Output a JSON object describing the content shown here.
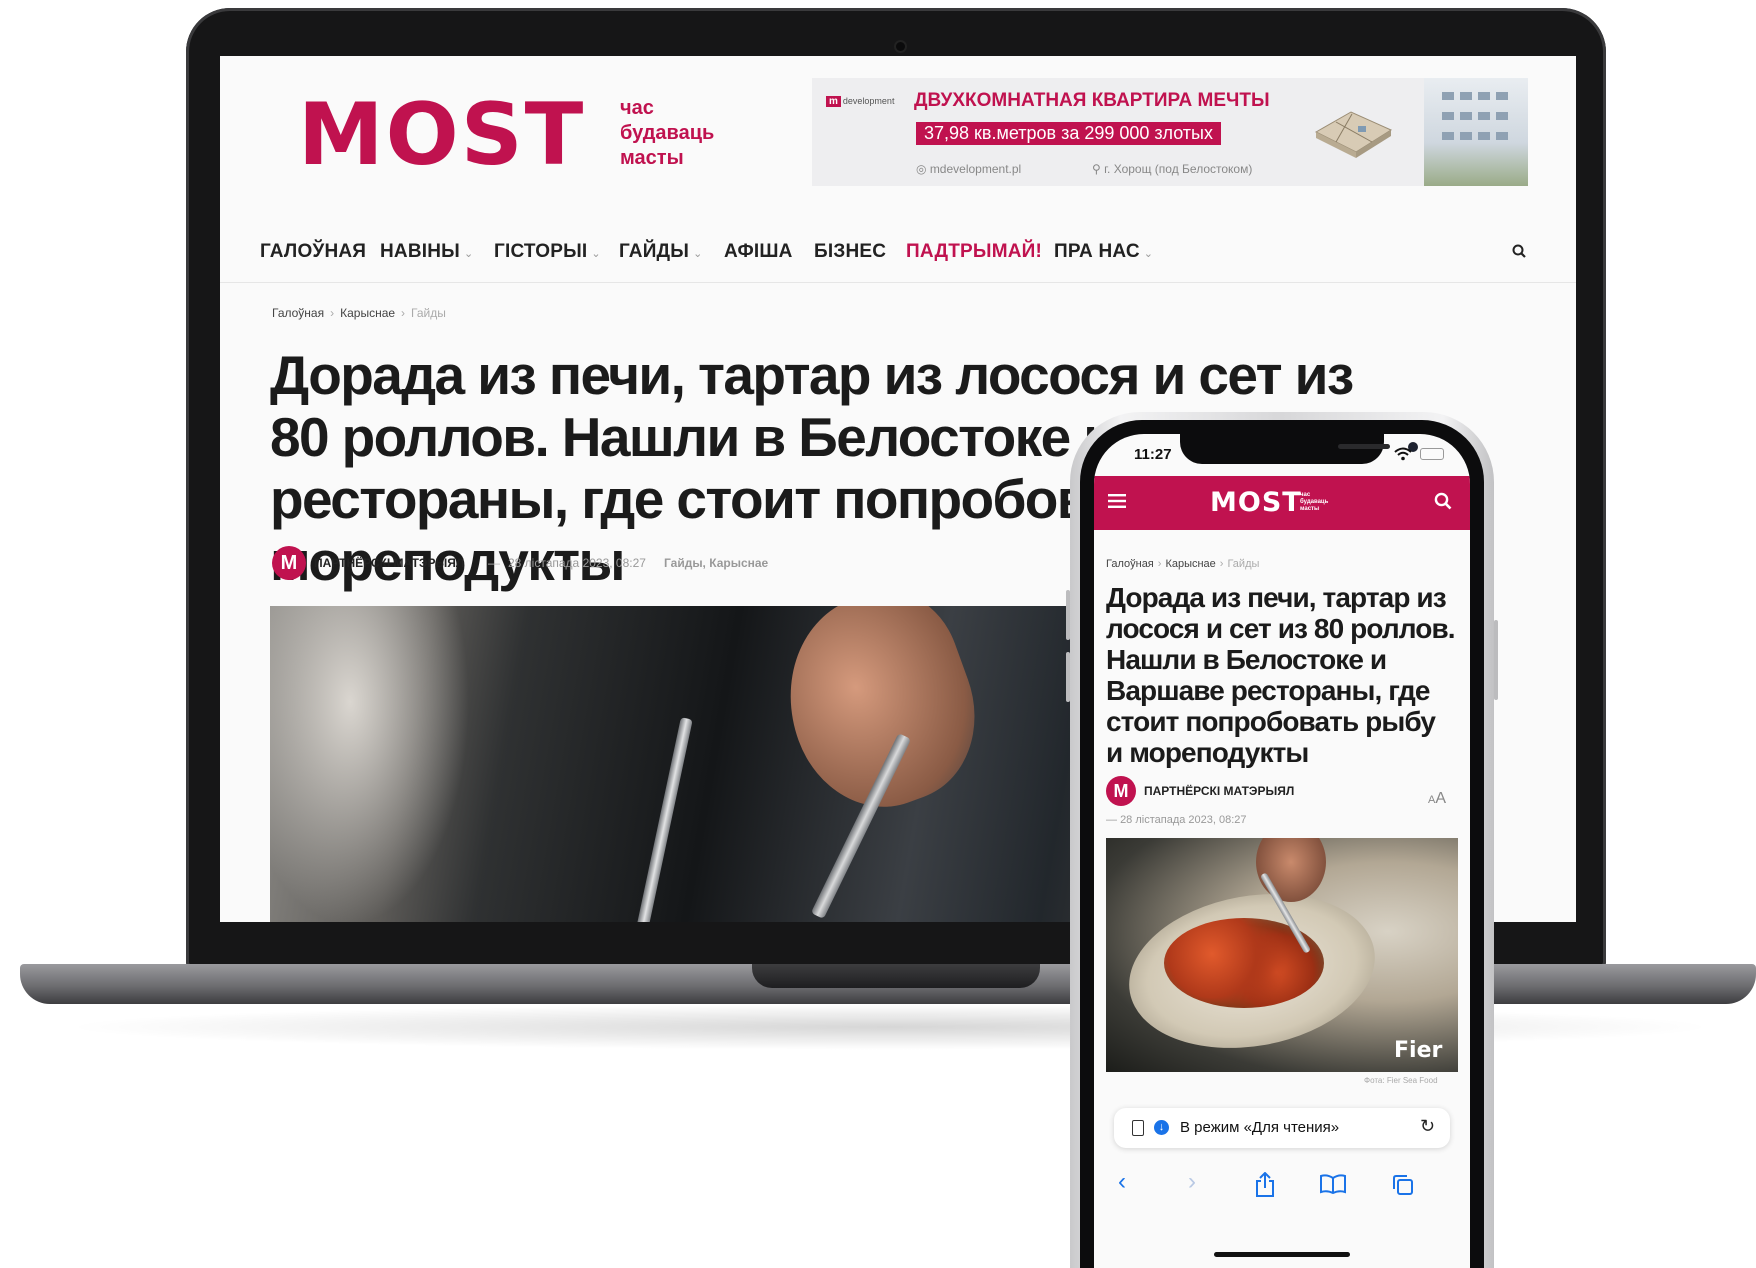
{
  "site": {
    "logo": "MOST",
    "tagline": [
      "час",
      "будаваць",
      "масты"
    ]
  },
  "ad": {
    "brand_mark": "m",
    "brand": "development",
    "headline": "ДВУХКОМНАТНАЯ КВАРТИРА МЕЧТЫ",
    "offer": "37,98 кв.метров за 299 000 злотых",
    "site": "mdevelopment.pl",
    "address": "г. Хорощ (под Белостоком)"
  },
  "nav": {
    "items": [
      {
        "label": "ГАЛОЎНАЯ",
        "has_menu": false
      },
      {
        "label": "НАВІНЫ",
        "has_menu": true
      },
      {
        "label": "ГІСТОРЫІ",
        "has_menu": true
      },
      {
        "label": "ГАЙДЫ",
        "has_menu": true
      },
      {
        "label": "АФІША",
        "has_menu": false
      },
      {
        "label": "БІЗНЕС",
        "has_menu": false
      },
      {
        "label": "ПАДТРЫМАЙ!",
        "has_menu": false,
        "highlight": true
      },
      {
        "label": "ПРА НАС",
        "has_menu": true
      }
    ],
    "chevron": "⌄",
    "search_icon": "search-icon"
  },
  "breadcrumb": {
    "home": "Галоўная",
    "section": "Карыснае",
    "current": "Гайды",
    "sep": "›"
  },
  "article": {
    "title_desktop": "Дорада из печи, тартар из лосося и сет из 80 роллов. Нашли в Белостоке и Варшаве рестораны, где стоит попробовать рыбу и мореподукты",
    "title_mobile": "Дорада из печи, тартар из лосося и сет из 80 роллов. Нашли в Белостоке и Варшаве рестораны, где стоит попробовать рыбу и мореподукты",
    "avatar_letter": "M",
    "author": "ПАРТНЁРСКІ МАТЭРЫЯЛ",
    "dash": "—",
    "date": "28 лістапада 2023, 08:27",
    "categories": "Гайды, Карыснае",
    "font_size_small": "A",
    "font_size_large": "A",
    "photo_credit": "Фота: Fier Sea Food",
    "photo_brand": "Fier"
  },
  "phone": {
    "time": "11:27",
    "url_text": "В режим «Для чтения»",
    "reload": "↻",
    "toolbar": [
      "‹",
      "›",
      "⇪",
      "📖",
      "⧉"
    ],
    "mobile_tagline": [
      "час",
      "будаваць",
      "масты"
    ]
  },
  "colors": {
    "brand": "#c0124f",
    "link_blue": "#1a73e8"
  }
}
